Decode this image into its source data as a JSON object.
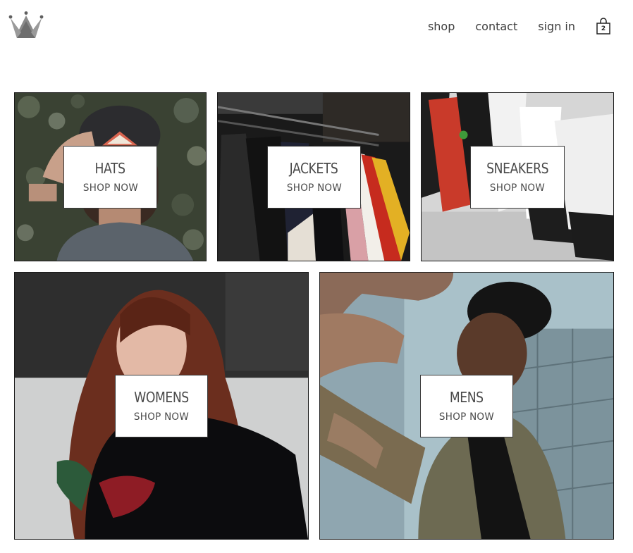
{
  "header": {
    "logo_icon": "crown-logo-icon",
    "nav": {
      "shop": "shop",
      "contact": "contact",
      "sign_in": "sign in"
    },
    "cart": {
      "icon": "shopping-bag-icon",
      "count": "2"
    }
  },
  "directory": {
    "hats": {
      "title": "HATS",
      "subtitle": "SHOP NOW"
    },
    "jackets": {
      "title": "JACKETS",
      "subtitle": "SHOP NOW"
    },
    "sneakers": {
      "title": "SNEAKERS",
      "subtitle": "SHOP NOW"
    },
    "womens": {
      "title": "WOMENS",
      "subtitle": "SHOP NOW"
    },
    "mens": {
      "title": "MENS",
      "subtitle": "SHOP NOW"
    }
  }
}
